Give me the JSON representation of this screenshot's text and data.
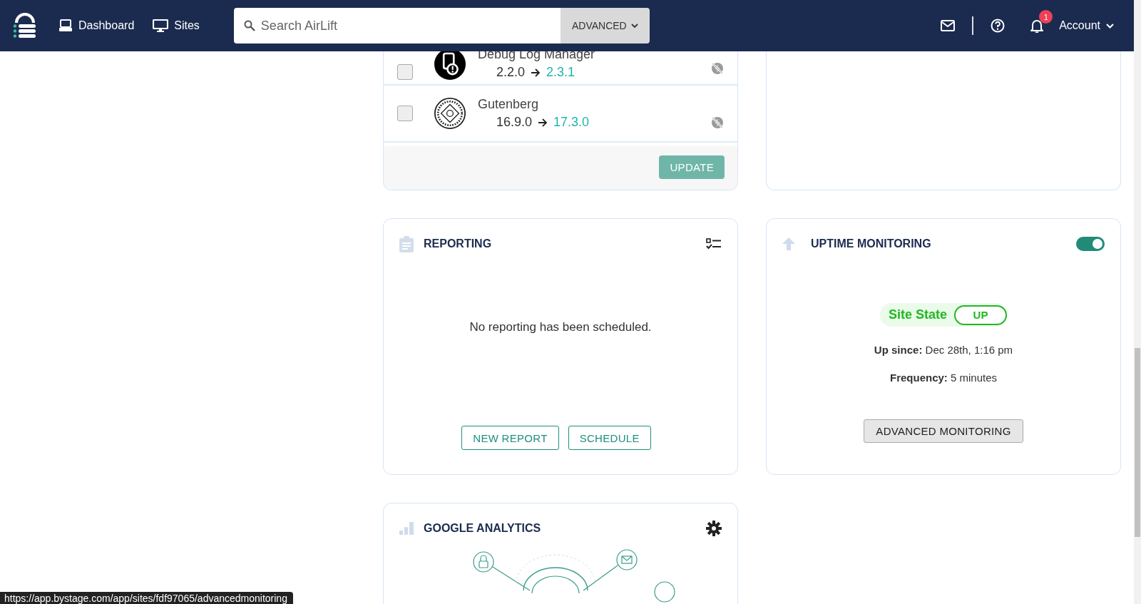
{
  "nav": {
    "links": [
      {
        "label": "Dashboard",
        "kind": "laptop"
      },
      {
        "label": "Sites",
        "kind": "monitor"
      }
    ],
    "search": {
      "placeholder": "Search AirLift"
    },
    "advanced": "ADVANCED",
    "notification_count": "1",
    "account": "Account"
  },
  "updates": {
    "plugins": [
      {
        "name": "Debug Log Manager",
        "current": "2.2.0",
        "latest": "2.3.1",
        "checked": false,
        "kind": "debug"
      },
      {
        "name": "Gutenberg",
        "current": "16.9.0",
        "latest": "17.3.0",
        "checked": false,
        "kind": "gutenberg"
      }
    ],
    "update_button": "UPDATE"
  },
  "reporting": {
    "title": "REPORTING",
    "message": "No reporting has been scheduled.",
    "buttons": [
      "NEW REPORT",
      "SCHEDULE"
    ]
  },
  "uptime": {
    "title": "UPTIME MONITORING",
    "on": true,
    "state_label": "Site State",
    "state": "UP",
    "details": [
      "**Up since:** Dec 28th, 1:16 pm",
      "**Frequency:** 5 minutes"
    ],
    "button": "ADVANCED MONITORING"
  },
  "analytics": {
    "title": "GOOGLE ANALYTICS"
  },
  "status_bar": {
    "url": "https://app.bystage.com/app/sites/fdf97065/advancedmonitoring"
  }
}
